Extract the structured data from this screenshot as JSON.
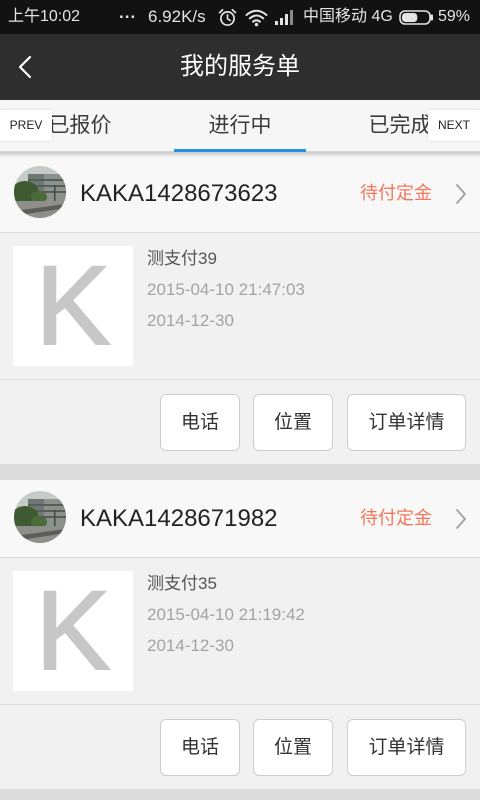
{
  "status_bar": {
    "time": "上午10:02",
    "notification_dots": "...",
    "net_speed": "6.92K/s",
    "carrier": "中国移动 4G",
    "battery_text": "59%",
    "battery_level": 0.59,
    "icons": [
      "alarm-icon",
      "wifi-icon",
      "signal-icon",
      "battery-icon"
    ]
  },
  "header": {
    "title": "我的服务单",
    "back_icon": "back-icon"
  },
  "tabs": {
    "prev_label": "PREV",
    "next_label": "NEXT",
    "items": [
      {
        "label": "已报价",
        "active": false
      },
      {
        "label": "进行中",
        "active": true
      },
      {
        "label": "已完成",
        "active": false
      }
    ]
  },
  "orders": [
    {
      "order_no": "KAKA1428673623",
      "status": "待付定金",
      "service": "测支付39",
      "created_at": "2015-04-10 21:47:03",
      "date": "2014-12-30",
      "thumb_letter": "K",
      "actions": {
        "phone": "电话",
        "location": "位置",
        "detail": "订单详情"
      }
    },
    {
      "order_no": "KAKA1428671982",
      "status": "待付定金",
      "service": "测支付35",
      "created_at": "2015-04-10 21:19:42",
      "date": "2014-12-30",
      "thumb_letter": "K",
      "actions": {
        "phone": "电话",
        "location": "位置",
        "detail": "订单详情"
      }
    }
  ],
  "colors": {
    "status_bar_bg": "#121212",
    "header_bg": "#2e2e2e",
    "tab_indicator": "#2a8ede",
    "order_status": "#f2775a"
  }
}
